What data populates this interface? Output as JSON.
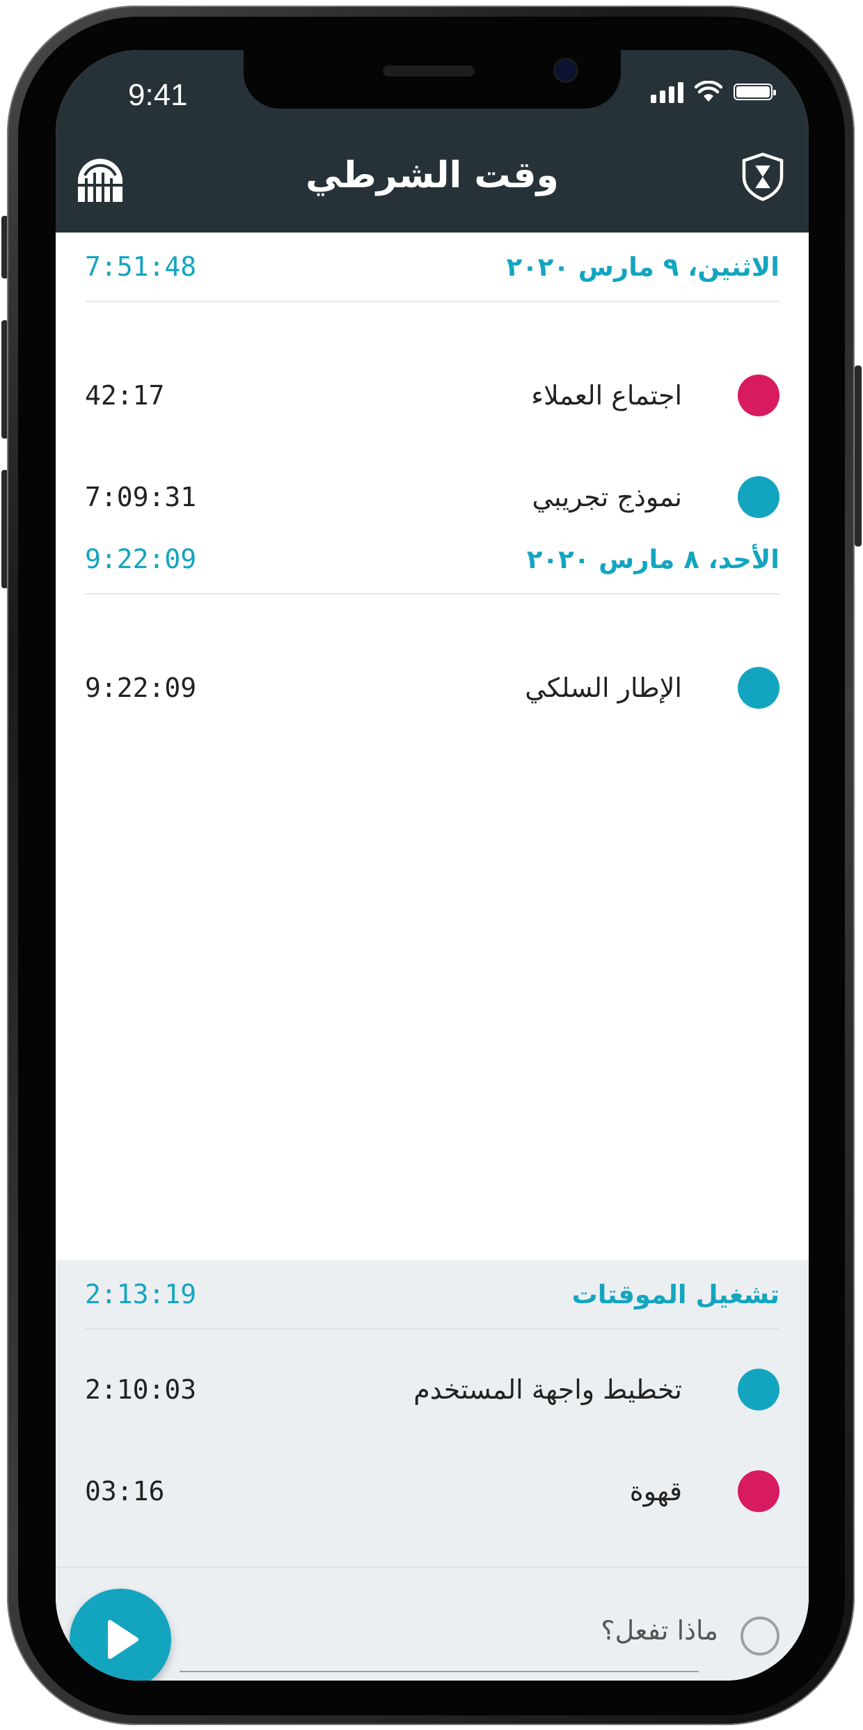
{
  "status_bar": {
    "time": "9:41"
  },
  "header": {
    "title": "وقت الشرطي",
    "left_icon": "timesheet-grid-icon",
    "right_icon": "police-badge-hourglass-icon"
  },
  "sections": [
    {
      "label": "الاثنين، ٩ مارس ٢٠٢٠",
      "total": "7:51:48",
      "entries": [
        {
          "name": "اجتماع العملاء",
          "duration": "42:17",
          "color": "#d81b60"
        },
        {
          "name": "نموذج تجريبي",
          "duration": "7:09:31",
          "color": "#13a5c0"
        }
      ]
    },
    {
      "label": "الأحد، ٨ مارس ٢٠٢٠",
      "total": "9:22:09",
      "entries": [
        {
          "name": "الإطار السلكي",
          "duration": "9:22:09",
          "color": "#13a5c0"
        }
      ]
    }
  ],
  "running": {
    "label": "تشغيل الموقتات",
    "total": "2:13:19",
    "entries": [
      {
        "name": "تخطيط واجهة المستخدم",
        "duration": "2:10:03",
        "color": "#13a5c0"
      },
      {
        "name": "قهوة",
        "duration": "03:16",
        "color": "#d81b60"
      }
    ]
  },
  "input": {
    "placeholder": "ماذا تفعل؟"
  },
  "colors": {
    "accent": "#13a5c0",
    "header_bg": "#263238",
    "pink": "#d81b60",
    "running_bg": "#eceff1"
  }
}
